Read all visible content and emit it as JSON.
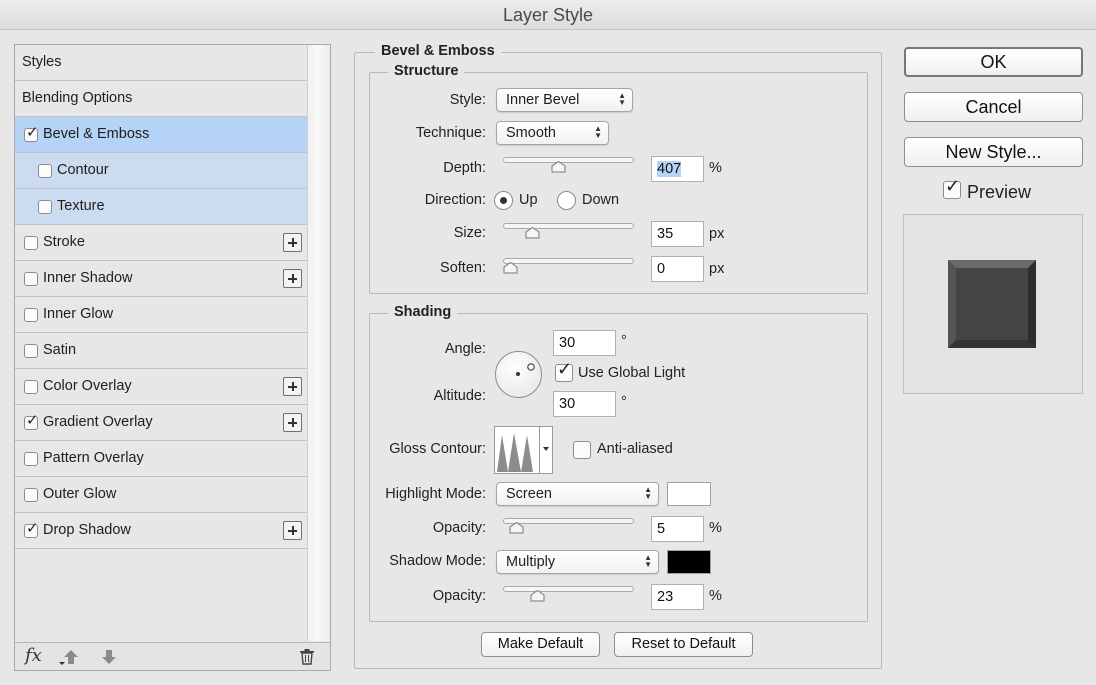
{
  "window": {
    "title": "Layer Style"
  },
  "styles_list": {
    "items": [
      {
        "label": "Styles",
        "checkable": false,
        "checked": false,
        "has_plus": false
      },
      {
        "label": "Blending Options",
        "checkable": false,
        "checked": false,
        "has_plus": false
      },
      {
        "label": "Bevel & Emboss",
        "checkable": true,
        "checked": true,
        "has_plus": false,
        "selected": true
      },
      {
        "label": "Contour",
        "checkable": true,
        "checked": false,
        "has_plus": false,
        "sub": true
      },
      {
        "label": "Texture",
        "checkable": true,
        "checked": false,
        "has_plus": false,
        "sub": true
      },
      {
        "label": "Stroke",
        "checkable": true,
        "checked": false,
        "has_plus": true
      },
      {
        "label": "Inner Shadow",
        "checkable": true,
        "checked": false,
        "has_plus": true
      },
      {
        "label": "Inner Glow",
        "checkable": true,
        "checked": false,
        "has_plus": false
      },
      {
        "label": "Satin",
        "checkable": true,
        "checked": false,
        "has_plus": false
      },
      {
        "label": "Color Overlay",
        "checkable": true,
        "checked": false,
        "has_plus": true
      },
      {
        "label": "Gradient Overlay",
        "checkable": true,
        "checked": true,
        "has_plus": true
      },
      {
        "label": "Pattern Overlay",
        "checkable": true,
        "checked": false,
        "has_plus": false
      },
      {
        "label": "Outer Glow",
        "checkable": true,
        "checked": false,
        "has_plus": false
      },
      {
        "label": "Drop Shadow",
        "checkable": true,
        "checked": true,
        "has_plus": true
      }
    ],
    "footer": {
      "fx_label": "fx"
    }
  },
  "bevel": {
    "section_title": "Bevel & Emboss",
    "structure": {
      "title": "Structure",
      "style_label": "Style:",
      "style_value": "Inner Bevel",
      "technique_label": "Technique:",
      "technique_value": "Smooth",
      "depth_label": "Depth:",
      "depth_value": "407",
      "depth_unit": "%",
      "direction_label": "Direction:",
      "direction_up": "Up",
      "direction_down": "Down",
      "direction_selected": "Up",
      "size_label": "Size:",
      "size_value": "35",
      "size_unit": "px",
      "soften_label": "Soften:",
      "soften_value": "0",
      "soften_unit": "px"
    },
    "shading": {
      "title": "Shading",
      "angle_label": "Angle:",
      "angle_value": "30",
      "angle_unit": "°",
      "global_light_label": "Use Global Light",
      "global_light_checked": true,
      "altitude_label": "Altitude:",
      "altitude_value": "30",
      "altitude_unit": "°",
      "gloss_label": "Gloss Contour:",
      "anti_aliased_label": "Anti-aliased",
      "anti_aliased_checked": false,
      "highlight_label": "Highlight Mode:",
      "highlight_value": "Screen",
      "highlight_color": "#ffffff",
      "highlight_opacity_label": "Opacity:",
      "highlight_opacity_value": "5",
      "highlight_opacity_unit": "%",
      "shadow_label": "Shadow Mode:",
      "shadow_value": "Multiply",
      "shadow_color": "#000000",
      "shadow_opacity_label": "Opacity:",
      "shadow_opacity_value": "23",
      "shadow_opacity_unit": "%"
    },
    "make_default": "Make Default",
    "reset_default": "Reset to Default"
  },
  "actions": {
    "ok": "OK",
    "cancel": "Cancel",
    "new_style": "New Style...",
    "preview_label": "Preview",
    "preview_checked": true
  },
  "sliders": {
    "depth_fraction": 0.41,
    "size_fraction": 0.19,
    "soften_fraction": 0.0,
    "highlight_opacity_fraction": 0.05,
    "shadow_opacity_fraction": 0.23
  },
  "colors": {
    "selection": "#b4d3f6",
    "sub_selection": "#cbdcf0",
    "preview_tile": "#3f3f3f"
  }
}
